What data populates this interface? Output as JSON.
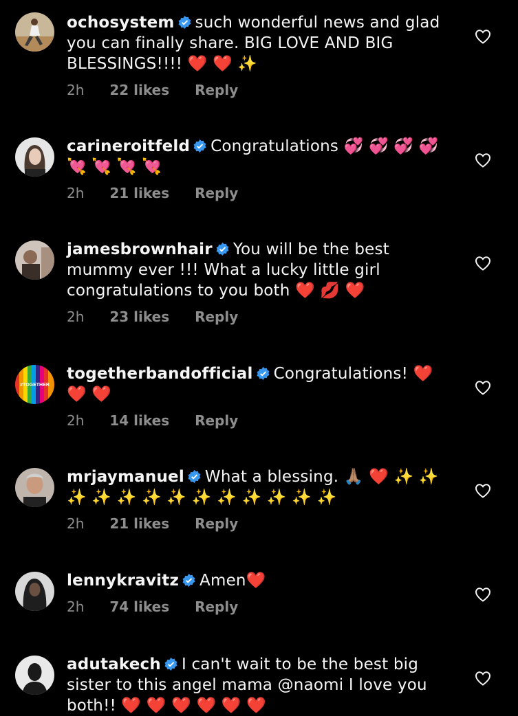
{
  "comments": [
    {
      "username": "ochosystem",
      "text": "such wonderful news and glad you can finally share. BIG LOVE AND BIG BLESSINGS!!!! ❤️ ❤️ ✨",
      "time": "2h",
      "likes": "22 likes",
      "reply": "Reply",
      "avatar_color": "#b38a5a"
    },
    {
      "username": "carineroitfeld",
      "text": "Congratulations 💞 💞 💞 💞 💘 💘 💘 💘",
      "time": "2h",
      "likes": "21 likes",
      "reply": "Reply",
      "avatar_color": "#d9d9d9"
    },
    {
      "username": "jamesbrownhair",
      "text": "You will be the best mummy ever !!! What a lucky little girl congratulations to you both ❤️ 💋 ❤️",
      "time": "2h",
      "likes": "23 likes",
      "reply": "Reply",
      "avatar_color": "#8a6a55"
    },
    {
      "username": "togetherbandofficial",
      "text": "Congratulations! ❤️ ❤️ ❤️",
      "time": "2h",
      "likes": "14 likes",
      "reply": "Reply",
      "avatar_label": "#TOGETHER"
    },
    {
      "username": "mrjaymanuel",
      "text": "What a blessing. 🙏🏽 ❤️ ✨ ✨ ✨ ✨ ✨ ✨ ✨ ✨ ✨ ✨ ✨ ✨ ✨",
      "time": "2h",
      "likes": "21 likes",
      "reply": "Reply",
      "avatar_color": "#9a8a80"
    },
    {
      "username": "lennykravitz",
      "text": "Amen❤️",
      "time": "2h",
      "likes": "74 likes",
      "reply": "Reply",
      "avatar_color": "#3a3a3a"
    },
    {
      "username": "adutakech",
      "text": "I can't wait to be the best big sister to this angel mama @naomi I love you both!! ❤️ ❤️ ❤️ ❤️ ❤️ ❤️",
      "time": "",
      "likes": "",
      "reply": "",
      "avatar_color": "#1a1a1a"
    }
  ],
  "colors": {
    "background": "#000000",
    "text": "#f5f5f5",
    "meta": "#8e8e8e",
    "verified": "#3897f0"
  },
  "icons": {
    "verified": "verified-badge-icon",
    "like": "heart-outline-icon"
  }
}
